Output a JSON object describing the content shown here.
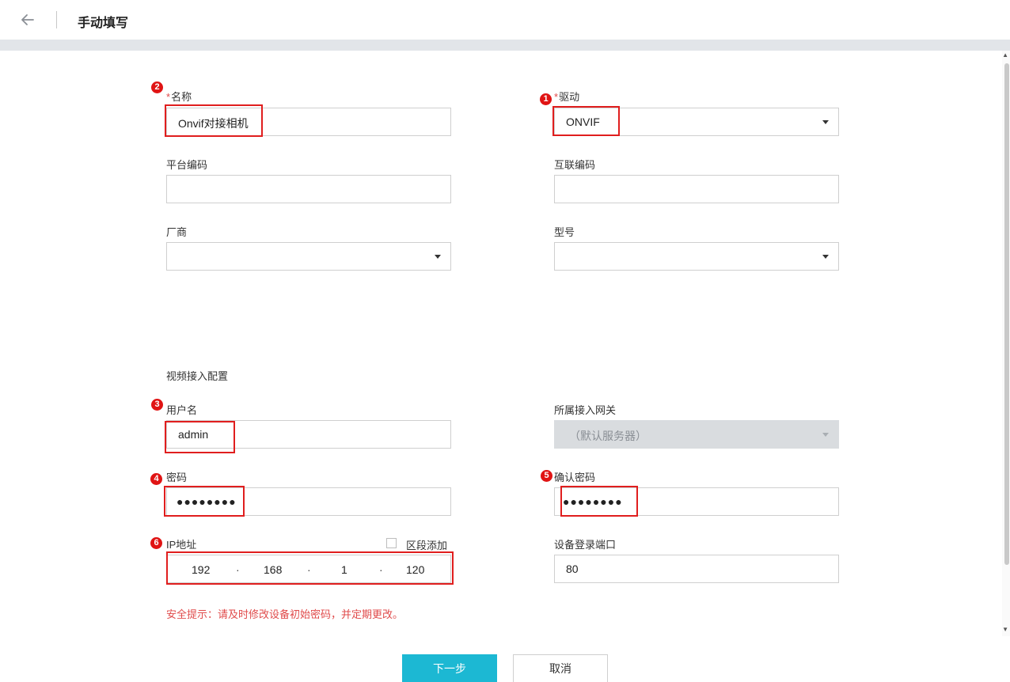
{
  "header": {
    "title": "手动填写",
    "back_icon": "arrow-left-icon"
  },
  "form": {
    "name": {
      "label": "名称",
      "required_mark": "*",
      "value": "Onvif对接相机"
    },
    "driver": {
      "label": "驱动",
      "required_mark": "*",
      "value": "ONVIF"
    },
    "platform_code": {
      "label": "平台编码",
      "value": ""
    },
    "interconnect_code": {
      "label": "互联编码",
      "value": ""
    },
    "vendor": {
      "label": "厂商",
      "value": ""
    },
    "model": {
      "label": "型号",
      "value": ""
    },
    "section_title": "视频接入配置",
    "username": {
      "label": "用户名",
      "value": "admin"
    },
    "gateway": {
      "label": "所属接入网关",
      "value": "（默认服务器）"
    },
    "password": {
      "label": "密码",
      "value": "●●●●●●●●"
    },
    "confirm_password": {
      "label": "确认密码",
      "value": "●●●●●●●●"
    },
    "ip": {
      "label": "IP地址",
      "segments": [
        "192",
        "168",
        "1",
        "120"
      ],
      "separator": "·"
    },
    "segment_add": {
      "label": "区段添加",
      "checked": false
    },
    "login_port": {
      "label": "设备登录端口",
      "value": "80"
    },
    "warning": "安全提示：请及时修改设备初始密码，并定期更改。"
  },
  "buttons": {
    "next": "下一步",
    "cancel": "取消"
  },
  "annotations": [
    "1",
    "2",
    "3",
    "4",
    "5",
    "6"
  ],
  "colors": {
    "accent": "#1cb8d3",
    "annotation": "#e01e1e",
    "warning": "#e04b4b"
  }
}
